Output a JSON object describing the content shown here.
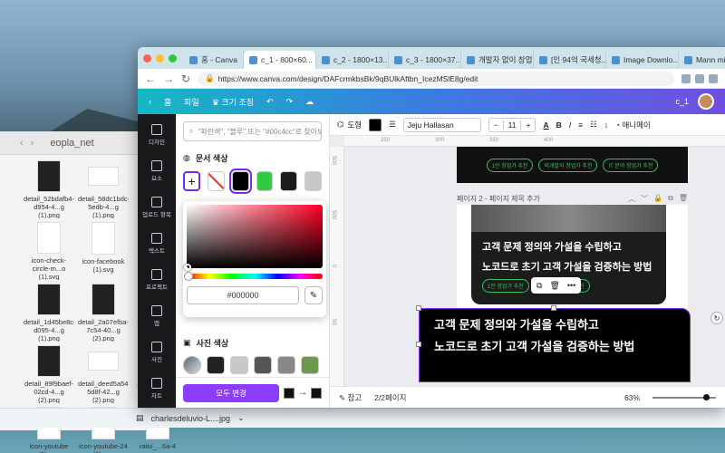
{
  "finder": {
    "title": "eopla_net",
    "files": [
      {
        "name": "detail_52bdafb4-d954-4...g (1).png",
        "kind": "dark"
      },
      {
        "name": "detail_58dc1bdc-5edb-4...g (1).png",
        "kind": "wide"
      },
      {
        "name": "detail_...a3fe",
        "kind": "dark"
      },
      {
        "name": "icon-check-circle-m...o (1).svg",
        "kind": "light"
      },
      {
        "name": "icon-facebook (1).svg",
        "kind": "light"
      },
      {
        "name": "icon-...",
        "kind": "light"
      },
      {
        "name": "detail_1d45be8c-d095-4...g (1).png",
        "kind": "dark"
      },
      {
        "name": "detail_2a07efba-7c54-40...g (2).png",
        "kind": "dark"
      },
      {
        "name": "detail_...6382",
        "kind": "dark"
      },
      {
        "name": "detail_89f9baef-02cd-4...g (2).png",
        "kind": "dark"
      },
      {
        "name": "detail_deed5a54-5d8f-42...g (2).png",
        "kind": "wide"
      },
      {
        "name": "detail_...a254",
        "kind": "dark"
      },
      {
        "name": "icon-youtube (2).svg",
        "kind": "light"
      },
      {
        "name": "icon-youtube-24 (2).svg",
        "kind": "light"
      },
      {
        "name": "ratio_...6a-4",
        "kind": "light"
      }
    ]
  },
  "downloads": {
    "file": "charlesdeluvio-L....jpg"
  },
  "browser": {
    "tabs": [
      {
        "label": "홈 - Canva",
        "active": false
      },
      {
        "label": "c_1 - 800×60...",
        "active": true
      },
      {
        "label": "c_2 - 1800×13...",
        "active": false
      },
      {
        "label": "c_3 - 1800×37...",
        "active": false
      },
      {
        "label": "개발자 없이 창업...",
        "active": false
      },
      {
        "label": "[인 94억 국세청...",
        "active": false
      },
      {
        "label": "Image Downlo...",
        "active": false
      },
      {
        "label": "Mann mit...",
        "active": false
      }
    ],
    "url": "https://www.canva.com/design/DAFcrmkbsBk/9qBUlkAftbn_IcezMSlE8g/edit"
  },
  "canva_header": {
    "home": "홈",
    "file": "파일",
    "resize": "크기 조정",
    "doc_name": "c_1"
  },
  "rail": [
    {
      "label": "디자인",
      "icon": "layout-icon"
    },
    {
      "label": "요소",
      "icon": "elements-icon"
    },
    {
      "label": "업로드 항목",
      "icon": "upload-icon"
    },
    {
      "label": "텍스트",
      "icon": "text-icon"
    },
    {
      "label": "프로젝트",
      "icon": "folder-icon"
    },
    {
      "label": "앱",
      "icon": "apps-icon"
    },
    {
      "label": "사진",
      "icon": "photo-icon"
    },
    {
      "label": "차트",
      "icon": "chart-icon"
    }
  ],
  "panel": {
    "search_placeholder": "\"파란색\", \"블루\" 또는 \"#00c4cc\"로 찾아보세",
    "doc_colors_title": "문서 색상",
    "doc_colors": [
      "#000000",
      "#2ecc40",
      "#1c1c1c",
      "#c8c8c8"
    ],
    "hex_value": "#000000",
    "photo_colors_title": "사진 색상",
    "photo_colors": [
      "#222222",
      "#c8c8c8",
      "#555555",
      "#888888",
      "#6d9a4a"
    ],
    "apply_all": "모두 변경"
  },
  "toolbar": {
    "style_label": "도형",
    "font": "Jeju Hallasan",
    "size": "11",
    "animate": "애니메이"
  },
  "canvas": {
    "page1_pills": [
      "1인 창업가 추천",
      "비개발자 창업가 추천",
      "IT 분야 창업가 추천"
    ],
    "page2_label": "페이지 2 - 페이지 제목 추가",
    "page2_line1": "고객 문제 정의와 가설을 수립하고",
    "page2_line2": "노코드로 초기 고객 가설을 검증하는 방법",
    "page2_pills": [
      "1인 창업가 추천",
      "IT 분야 창업가 추천"
    ],
    "selected_line1": "고객 문제 정의와 가설을 수립하고",
    "selected_line2": "노코드로 초기 고객 가설을 검증하는 방법"
  },
  "status": {
    "notes": "참고",
    "pages": "2/2페이지",
    "zoom": "63%"
  }
}
